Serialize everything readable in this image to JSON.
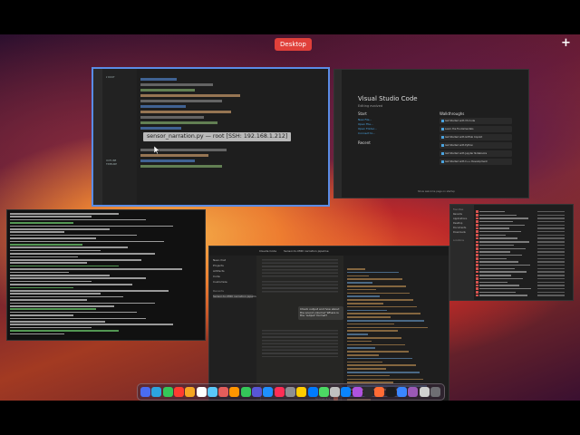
{
  "mission_control": {
    "space_label": "Desktop",
    "add_space": "+"
  },
  "vscode_editor": {
    "tooltip": "sensor_narration.py — root [SSH: 192.168.1.212]",
    "tab": "sensor_narration.py",
    "explorer_items": [
      "OUTLINE",
      "TIMELINE"
    ]
  },
  "vscode_welcome": {
    "title": "Visual Studio Code",
    "subtitle": "Editing evolved",
    "start_heading": "Start",
    "start_links": [
      "New File...",
      "Open File...",
      "Open Folder...",
      "Connect to..."
    ],
    "recent_heading": "Recent",
    "walkthroughs_heading": "Walkthroughs",
    "walkthroughs": [
      "Get Started with VS Code",
      "Learn the Fundamentals",
      "Get Started with GitHub Copilot",
      "Get Started with Python",
      "Get Started with Jupyter Notebooks",
      "Get Started with C++ Development"
    ],
    "footer": "Show welcome page on startup"
  },
  "claude": {
    "sidebar_items": [
      "New chat",
      "Projects",
      "Artifacts",
      "Code",
      "Customize",
      "Recents"
    ],
    "highlight_item": "Sensor-to-MIDI narration pipeline",
    "tabs": [
      "Claude Code",
      "Sensor-to-MIDI narration pipeline"
    ],
    "bubble": "Check output and how about the sound volume? Where is the 'output' format?",
    "input_placeholder": "Reply to Claude...",
    "model": "Sonnet 4.5"
  },
  "finder": {
    "sidebar": [
      "Favorites",
      "Recents",
      "Applications",
      "Desktop",
      "Documents",
      "Downloads",
      "Locations"
    ]
  }
}
